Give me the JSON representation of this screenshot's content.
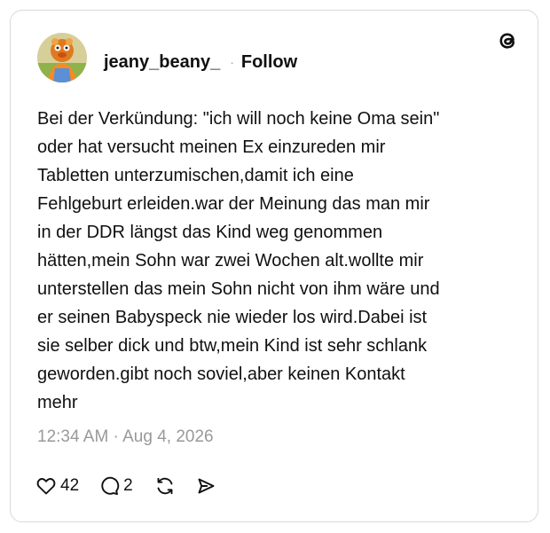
{
  "post": {
    "username": "jeany_beany_",
    "separator": "·",
    "follow_label": "Follow",
    "text": "Bei der Verkündung: \"ich will noch keine Oma sein\"\noder hat versucht meinen Ex einzureden mir\nTabletten unterzumischen,damit ich eine\nFehlgeburt erleiden.war der Meinung das man mir\nin der DDR längst das Kind weg genommen\nhätten,mein Sohn war zwei Wochen alt.wollte mir\nunterstellen das mein Sohn nicht von ihm wäre und\ner seinen Babyspeck nie wieder los wird.Dabei ist\nsie selber dick und btw,mein Kind ist sehr schlank\ngeworden.gibt noch soviel,aber keinen Kontakt\nmehr",
    "timestamp": "12:34 AM · Aug 4, 2026"
  },
  "actions": {
    "likes": "42",
    "replies": "2"
  },
  "icons": {
    "logo": "threads-logo-icon",
    "like": "heart-icon",
    "reply": "comment-bubble-icon",
    "repost": "repost-icon",
    "share": "send-icon"
  }
}
